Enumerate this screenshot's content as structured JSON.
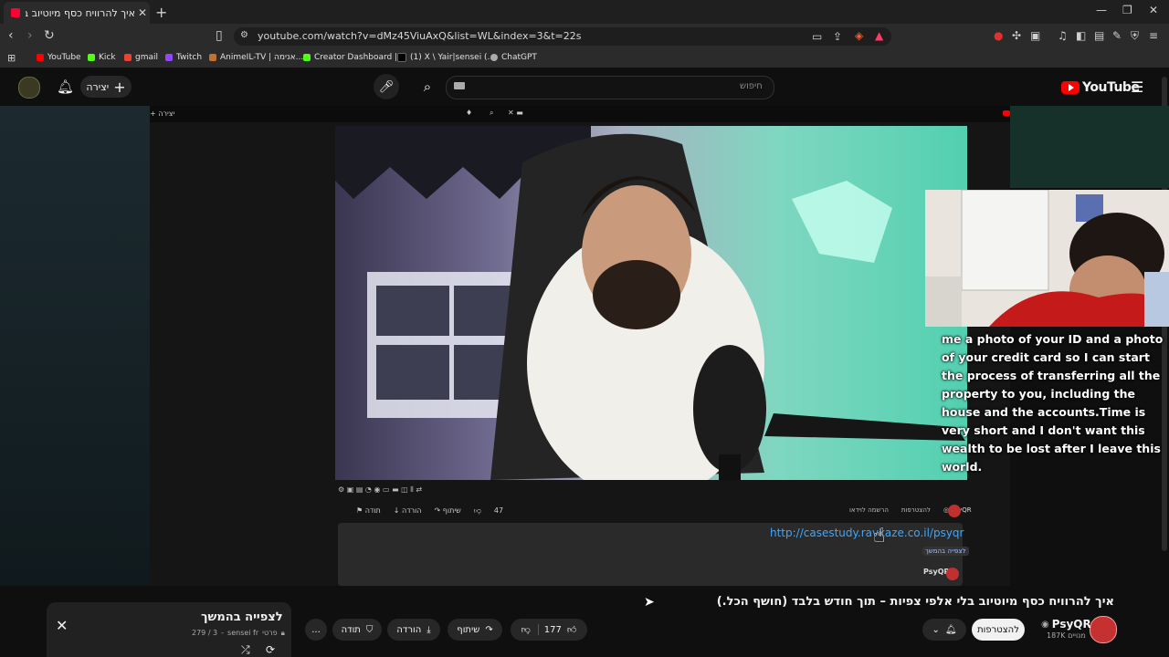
{
  "browser": {
    "tab_title": "איך להרוויח כסף מיוטיוב בלי אלפי",
    "new_tab": "+",
    "url": "youtube.com/watch?v=dMz45ViuAxQ&list=WL&index=3&t=22s",
    "bookmarks": [
      "YouTube",
      "Kick",
      "gmail",
      "Twitch",
      "AnimeIL-TV | אנימה...",
      "Creator Dashboard |...",
      "(1) X \\ Yair|sensei (...",
      "ChatGPT"
    ]
  },
  "youtube": {
    "logo": "YouTube",
    "search_placeholder": "חיפוש",
    "create_label": "יצירה",
    "video_title": "איך להרוויח כסף מיוטיוב בלי אלפי צפיות – תוך חודש בלבד (חושף הכל.)",
    "channel": "PsyQR",
    "subscribers": "187K מנויים",
    "subscribe_label": "להצטרפות",
    "likes": "177",
    "share_label": "שיתוף",
    "download_label": "הורדה",
    "thanks_label": "תודה",
    "more_label": "..."
  },
  "inner": {
    "link": "http://casestudy.ravkaze.co.il/psyqr",
    "channel": "PsyQR",
    "likes": "47"
  },
  "webcam": {
    "caption": "me a photo of your ID and a photo of your credit card so I can start the process of transferring all the property to you, including the house and the accounts.Time is very short and I don't want this wealth to be lost after I leave this world."
  },
  "playlist": {
    "title": "לצפייה בהמשך",
    "meta_owner": "sensei fr",
    "meta_privacy": "פרטי",
    "meta_position": "279 / 3"
  },
  "colors": {
    "accent": "#ff0000",
    "link": "#3ea6ff"
  }
}
